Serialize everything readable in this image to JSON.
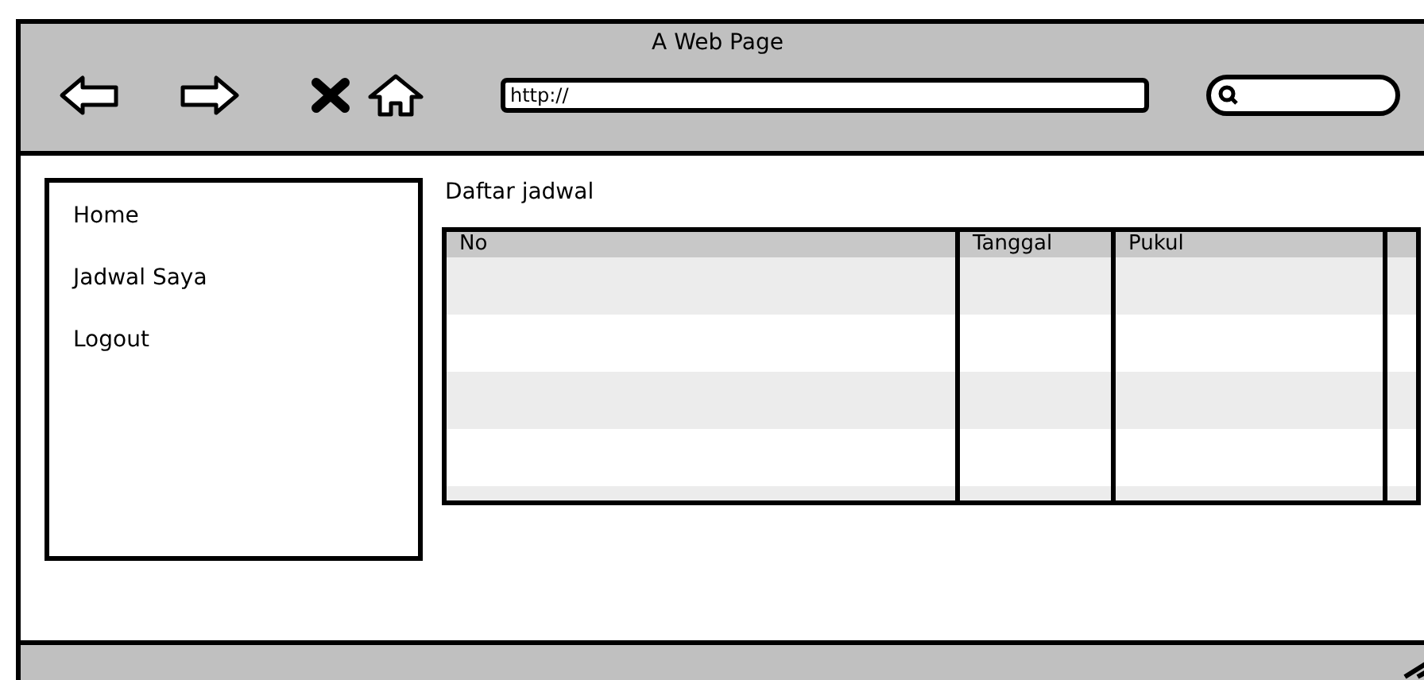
{
  "window": {
    "title": "A Web Page"
  },
  "toolbar": {
    "url": "http://"
  },
  "sidebar": {
    "items": [
      {
        "label": "Home"
      },
      {
        "label": "Jadwal Saya"
      },
      {
        "label": "Logout"
      }
    ]
  },
  "content": {
    "heading": "Daftar jadwal"
  },
  "table": {
    "columns": [
      "No",
      "Tanggal",
      "Pukul"
    ]
  }
}
